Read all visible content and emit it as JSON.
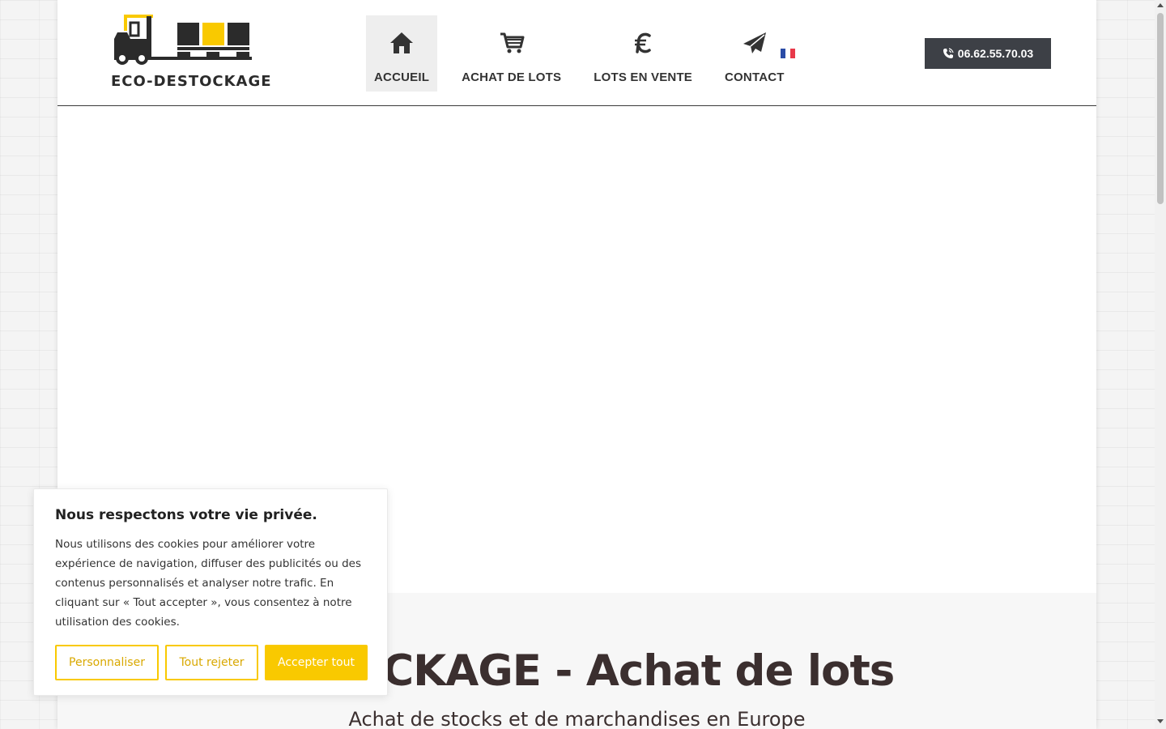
{
  "header": {
    "logo_text": "ECO-DESTOCKAGE",
    "nav": [
      {
        "label": "ACCUEIL",
        "icon": "home-icon",
        "active": true
      },
      {
        "label": "ACHAT DE LOTS",
        "icon": "cart-icon",
        "active": false
      },
      {
        "label": "LOTS EN VENTE",
        "icon": "euro-icon",
        "active": false
      },
      {
        "label": "CONTACT",
        "icon": "paper-plane-icon",
        "active": false
      }
    ],
    "language_flag": "france-flag-icon",
    "phone": "06.62.55.70.03"
  },
  "band": {
    "title": "ESTOCKAGE - Achat de lots",
    "subtitle": "Achat de stocks et de marchandises en Europe"
  },
  "cookie_banner": {
    "title": "Nous respectons votre vie privée.",
    "text": "Nous utilisons des cookies pour améliorer votre expérience de navigation, diffuser des publicités ou des contenus personnalisés et analyser notre trafic. En cliquant sur « Tout accepter », vous consentez à notre utilisation des cookies.",
    "customize_label": "Personnaliser",
    "reject_label": "Tout rejeter",
    "accept_label": "Accepter tout"
  },
  "colors": {
    "accent": "#f9c900",
    "dark": "#3d4046",
    "heading": "#3b2f2f"
  }
}
